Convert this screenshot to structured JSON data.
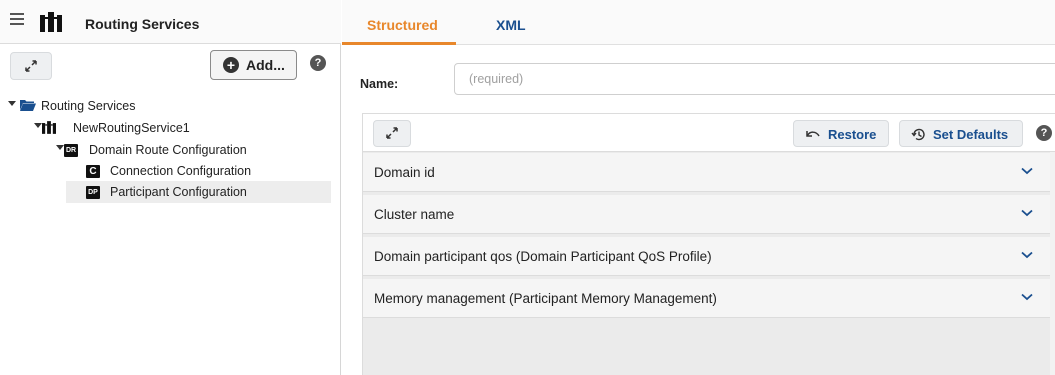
{
  "left_panel": {
    "title": "Routing Services",
    "add_label": "Add...",
    "help": "?",
    "tree": {
      "root": "Routing Services",
      "service": "NewRoutingService1",
      "domain_route": "Domain Route Configuration",
      "domain_route_badge": "DR",
      "connection": "Connection Configuration",
      "connection_badge": "C",
      "participant": "Participant Configuration",
      "participant_badge": "DP"
    }
  },
  "tabs": [
    {
      "label": "Structured",
      "active": true
    },
    {
      "label": "XML",
      "active": false
    }
  ],
  "form": {
    "name_label": "Name:",
    "name_value": "",
    "name_placeholder": "(required)"
  },
  "panel": {
    "restore_label": "Restore",
    "defaults_label": "Set Defaults",
    "help": "?",
    "sections": [
      {
        "label": "Domain id"
      },
      {
        "label": "Cluster name"
      },
      {
        "label": "Domain participant qos (Domain Participant QoS Profile)"
      },
      {
        "label": "Memory management (Participant Memory Management)"
      }
    ]
  },
  "colors": {
    "accent_orange": "#e8872b",
    "link_blue": "#1a4f8f",
    "selection_bg": "#ededed"
  }
}
